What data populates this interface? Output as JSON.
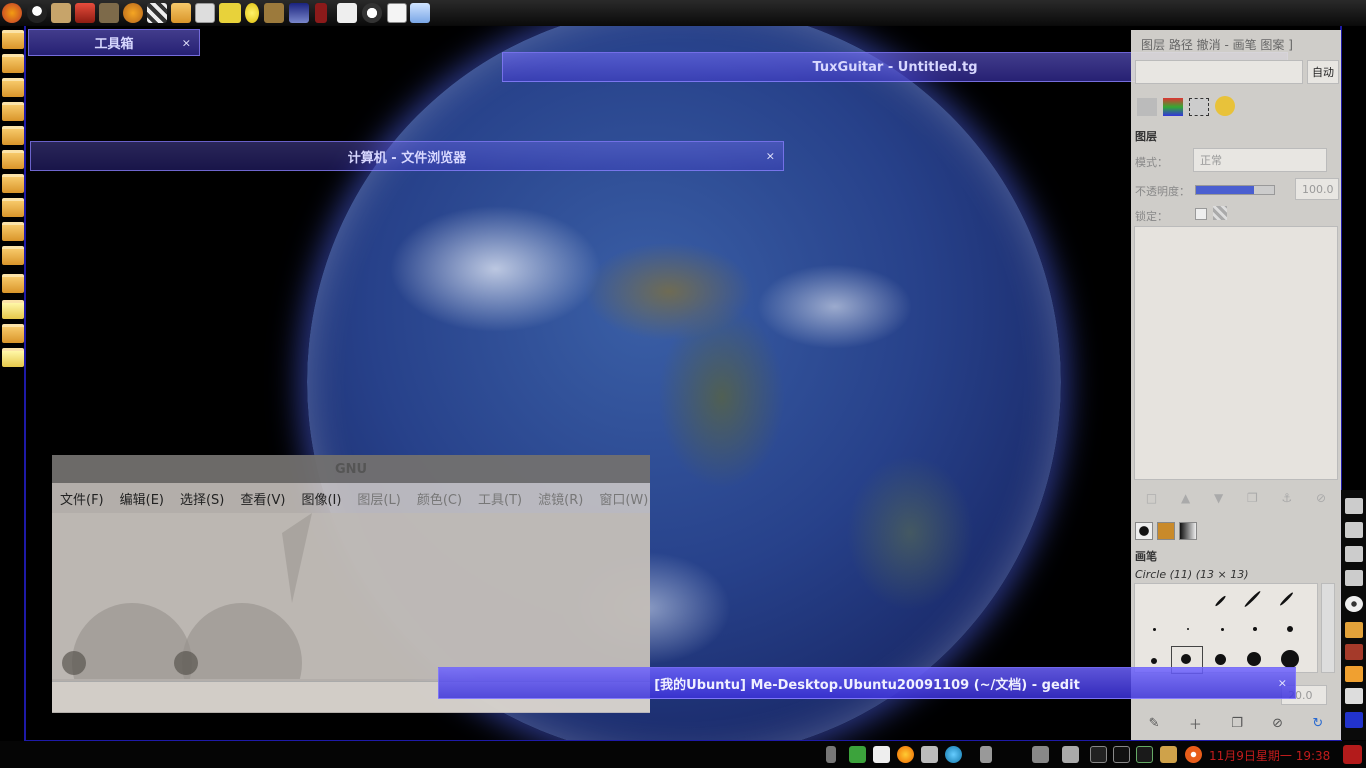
{
  "windows": {
    "toolbox_title": "工具箱",
    "tuxguitar_title": "TuxGuitar - Untitled.tg",
    "filebrowser_title": "计算机 - 文件浏览器",
    "gimp_title": "GNU",
    "gedit_title": "[我的Ubuntu] Me-Desktop.Ubuntu20091109 (~/文档) - gedit",
    "close_glyph": "×"
  },
  "gimp": {
    "menu": [
      "文件(F)",
      "编辑(E)",
      "选择(S)",
      "查看(V)",
      "图像(I)",
      "图层(L)",
      "颜色(C)",
      "工具(T)",
      "滤镜(R)",
      "窗口(W)"
    ]
  },
  "dock": {
    "top_title": "图层 路径 撤消 - 画笔 图案 ]",
    "auto_button": "自动",
    "layers_header": "图层",
    "mode_label": "模式：",
    "mode_value": "正常",
    "opacity_label": "不透明度：",
    "opacity_value": "100.0",
    "lock_label": "锁定：",
    "brushes_header": "画笔",
    "brush_name": "Circle (11) (13 × 13)",
    "spacing_value": "20.0"
  },
  "panel": {
    "clock": "11月9日星期一 19:38"
  },
  "colors": {
    "frame": "#1e1aa8",
    "titlebar": "#6a5fe0",
    "clock": "#c21c1c"
  }
}
